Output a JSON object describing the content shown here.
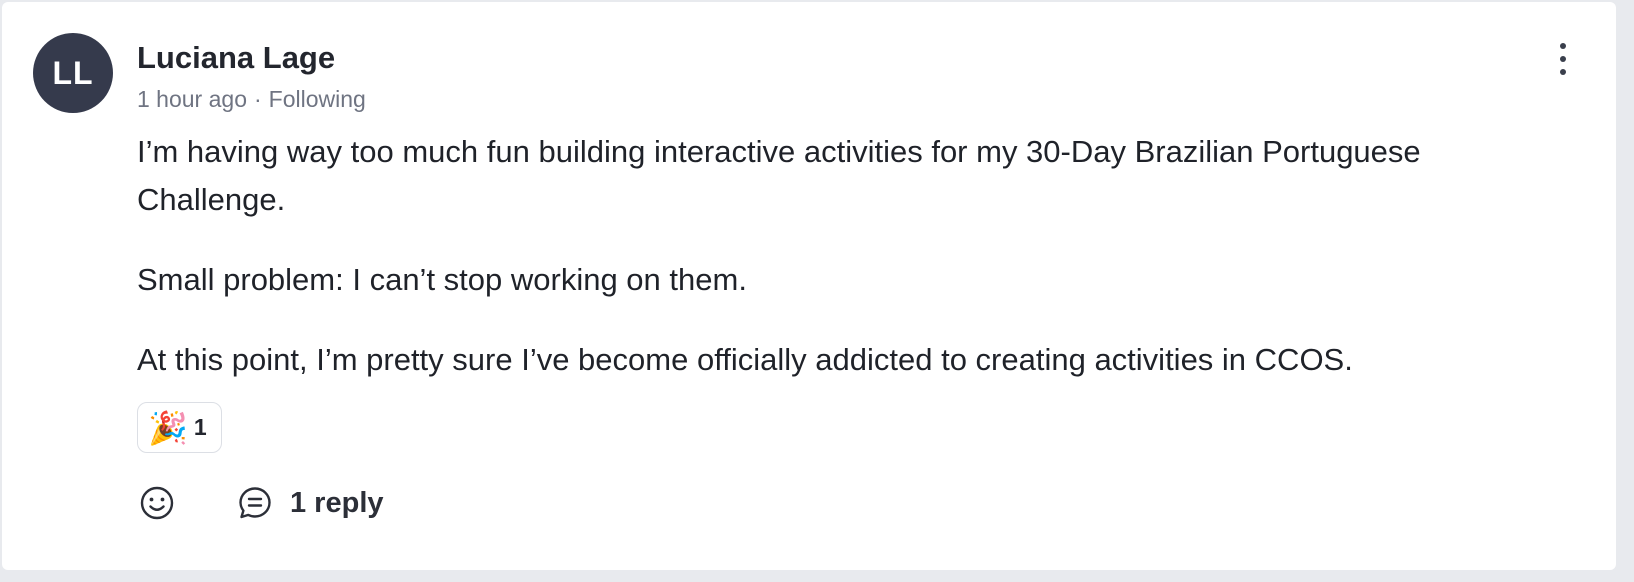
{
  "post": {
    "avatar_initials": "LL",
    "author": "Luciana Lage",
    "time": "1 hour ago",
    "separator": "·",
    "follow_status": "Following",
    "paragraphs": [
      "I’m having way too much fun building interactive activities for my 30-Day Brazilian Portuguese Challenge.",
      "Small problem: I can’t stop working on them.",
      "At this point, I’m pretty sure I’ve become officially addicted to creating activities in CCOS."
    ],
    "reaction": {
      "emoji": "🎉",
      "count": "1"
    },
    "actions": {
      "react_icon": "smile-icon",
      "reply_icon": "comment-icon",
      "reply_label": "1 reply",
      "more_icon": "more-vertical-icon"
    }
  },
  "colors": {
    "avatar_bg": "#353a4c",
    "text": "#1f2229",
    "muted": "#6f7482",
    "page_bg": "#e8eaee"
  }
}
